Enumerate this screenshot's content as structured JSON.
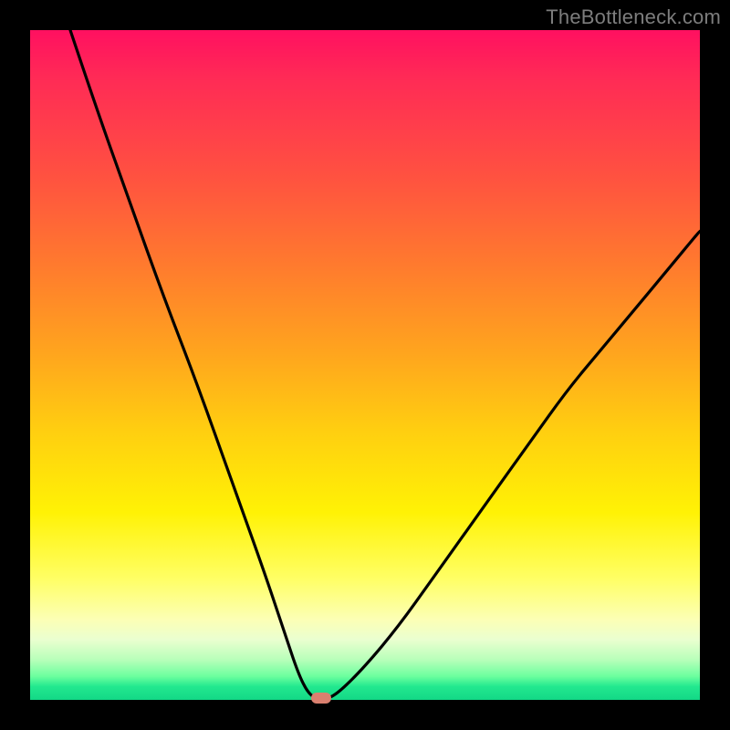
{
  "watermark": "TheBottleneck.com",
  "chart_data": {
    "type": "line",
    "title": "",
    "xlabel": "",
    "ylabel": "",
    "xlim": [
      0,
      100
    ],
    "ylim": [
      0,
      100
    ],
    "grid": false,
    "series": [
      {
        "name": "bottleneck-curve",
        "x": [
          6,
          10,
          15,
          20,
          25,
          30,
          35,
          38,
          40,
          41.5,
          43,
          44,
          46,
          50,
          55,
          60,
          65,
          70,
          75,
          80,
          85,
          90,
          95,
          100
        ],
        "values": [
          100,
          88,
          74,
          60,
          47,
          33,
          19,
          10,
          4,
          1,
          0,
          0,
          1,
          5,
          11,
          18,
          25,
          32,
          39,
          46,
          52,
          58,
          64,
          70
        ]
      }
    ],
    "marker": {
      "x": 43.5,
      "y": 0,
      "color": "#da806f"
    },
    "background_gradient": {
      "stops": [
        {
          "pct": 0,
          "color": "#ff1060"
        },
        {
          "pct": 35,
          "color": "#ff7a2e"
        },
        {
          "pct": 72,
          "color": "#fff205"
        },
        {
          "pct": 100,
          "color": "#13d886"
        }
      ]
    }
  }
}
